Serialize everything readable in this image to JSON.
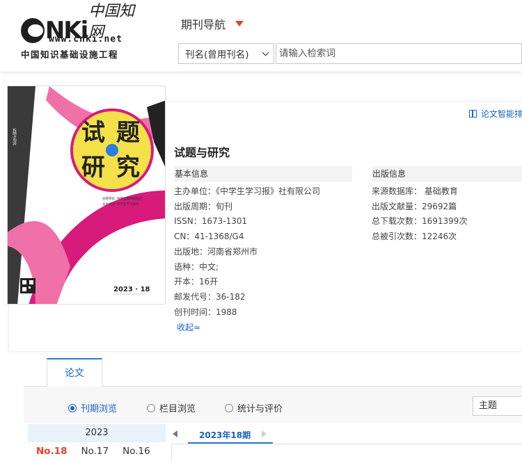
{
  "header": {
    "logo_brand": "CNKi",
    "logo_cn": "中国知网",
    "logo_url": "www.cnki.net",
    "logo_subtitle": "中国知识基础设施工程",
    "nav_title": "期刊导航",
    "search_select": "刊名(曾用刊名)",
    "search_placeholder": "请输入检索词"
  },
  "cover": {
    "title_chars": [
      "试",
      "题",
      "研",
      "究"
    ],
    "issue": "2023 · 18",
    "side_text": "试题与研究",
    "publisher_line1": "主管单位: 中原出版传媒集团",
    "publisher_line2": "主办单位: 中学生学习报社"
  },
  "journal": {
    "smart_sort_label": "论文智能排序",
    "title": "试题与研究",
    "basic_info_heading": "基本信息",
    "publish_info_heading": "出版信息",
    "basic_info": [
      "主办单位：《中学生学习报》社有限公司",
      "出版周期：旬刊",
      "ISSN：1673-1301",
      "CN：41-1368/G4",
      "出版地：河南省郑州市",
      "语种：中文;",
      "开本：16开",
      "邮发代号：36-182",
      "创刊时间：1988"
    ],
    "publish_info": [
      "来源数据库： 基础教育",
      "出版文献量：29692篇",
      "总下载次数：1691399次",
      "总被引次数：12246次"
    ],
    "collapse_label": "收起≈"
  },
  "tabs": {
    "articles": "论文"
  },
  "filters": {
    "options": [
      "刊期浏览",
      "栏目浏览",
      "统计与评价"
    ],
    "active": "刊期浏览",
    "subject_select": "主题"
  },
  "issues": {
    "year": "2023",
    "list": [
      "No.18",
      "No.17",
      "No.16"
    ],
    "active": "No.18",
    "period_label": "2023年18期"
  },
  "colors": {
    "accent_blue": "#1a62c5",
    "accent_red": "#e8412c",
    "cover_magenta": "#d81b7a",
    "cover_yellow": "#f4e14a"
  }
}
